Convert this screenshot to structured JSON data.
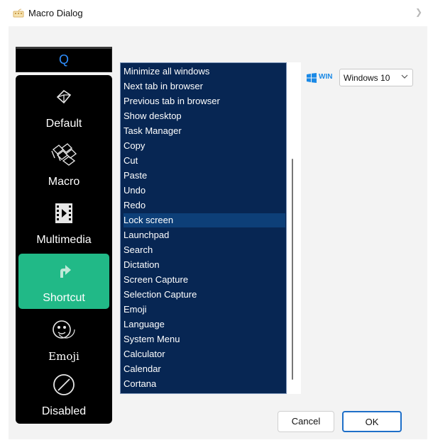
{
  "window": {
    "title": "Macro Dialog"
  },
  "key_display": {
    "value": "Q"
  },
  "sidebar": {
    "items": [
      {
        "label": "Default",
        "icon": "cube-icon",
        "active": false
      },
      {
        "label": "Macro",
        "icon": "keys-icon",
        "active": false
      },
      {
        "label": "Multimedia",
        "icon": "film-icon",
        "active": false
      },
      {
        "label": "Shortcut",
        "icon": "shortcut-arrow-icon",
        "active": true
      },
      {
        "label": "Emoji",
        "icon": "emoji-icon",
        "active": false
      },
      {
        "label": "Disabled",
        "icon": "disabled-icon",
        "active": false
      }
    ]
  },
  "shortcut_list": {
    "items": [
      "Minimize all windows",
      "Next tab in browser",
      "Previous tab in browser",
      "Show desktop",
      "Task Manager",
      "Copy",
      "Cut",
      "Paste",
      "Undo",
      "Redo",
      "Lock screen",
      "Launchpad",
      "Search",
      "Dictation",
      "Screen Capture",
      "Selection Capture",
      "Emoji",
      "Language",
      "System Menu",
      "Calculator",
      "Calendar",
      "Cortana"
    ],
    "highlighted": "Lock screen"
  },
  "os": {
    "badge": "WIN",
    "selected": "Windows 10"
  },
  "buttons": {
    "cancel": "Cancel",
    "ok": "OK"
  },
  "colors": {
    "accent": "#21b987",
    "list_bg": "#072653",
    "list_highlight": "#0d3f78",
    "win_blue": "#1a89e6",
    "ok_border": "#1e6fc8"
  }
}
